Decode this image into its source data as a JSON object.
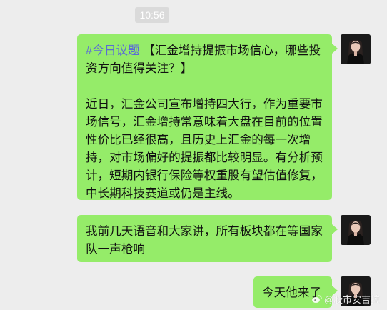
{
  "time": "10:56",
  "messages": [
    {
      "tag": "#今日议题",
      "headline": "【汇金增持提振市场信心，哪些投资方向值得关注？】",
      "body": "近日，汇金公司宣布增持四大行，作为重要市场信号，汇金增持常意味着大盘在目前的位置性价比已经很高，且历史上汇金的每一次增持，对市场偏好的提振都比较明显。有分析预计，短期内银行保险等权重股有望估值修复，中长期科技赛道或仍是主线。"
    },
    {
      "text": "我前几天语音和大家讲，所有板块都在等国家队一声枪响"
    },
    {
      "text": "今天他来了"
    }
  ],
  "watermark": {
    "text": "@股市安吉拉",
    "icon": "weibo-icon"
  },
  "colors": {
    "background": "#ededed",
    "bubble": "#95ec69",
    "tag": "#5b6bd6",
    "timestamp_bg": "#dadada"
  }
}
